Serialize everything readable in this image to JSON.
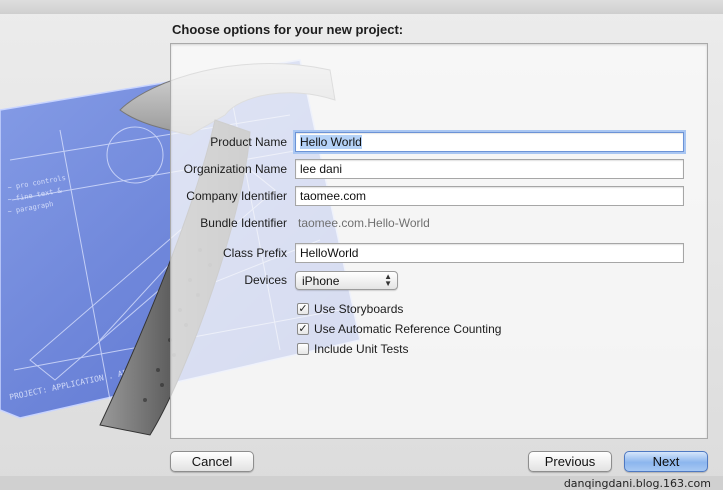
{
  "window": {
    "heading": "Choose options for your new project:"
  },
  "form": {
    "product_name_label": "Product Name",
    "product_name_value": "Hello World",
    "organization_name_label": "Organization Name",
    "organization_name_value": "lee dani",
    "company_identifier_label": "Company Identifier",
    "company_identifier_value": "taomee.com",
    "bundle_identifier_label": "Bundle Identifier",
    "bundle_identifier_value": "taomee.com.Hello-World",
    "class_prefix_label": "Class Prefix",
    "class_prefix_value": "HelloWorld",
    "devices_label": "Devices",
    "devices_value": "iPhone",
    "options": [
      {
        "label": "Use Storyboards",
        "checked": true
      },
      {
        "label": "Use Automatic Reference Counting",
        "checked": true
      },
      {
        "label": "Include Unit Tests",
        "checked": false
      }
    ]
  },
  "buttons": {
    "cancel": "Cancel",
    "previous": "Previous",
    "next": "Next"
  },
  "watermark": "danqingdani.blog.163.com",
  "colors": {
    "blueprint": "#5b78d9",
    "focus_ring": "#a9c6f2",
    "default_button": "#8cb6ee"
  },
  "icons": {
    "art": "xcode-hammer-blueprint-icon",
    "checkbox": "checkmark-icon",
    "popup": "up-down-arrows-icon"
  }
}
